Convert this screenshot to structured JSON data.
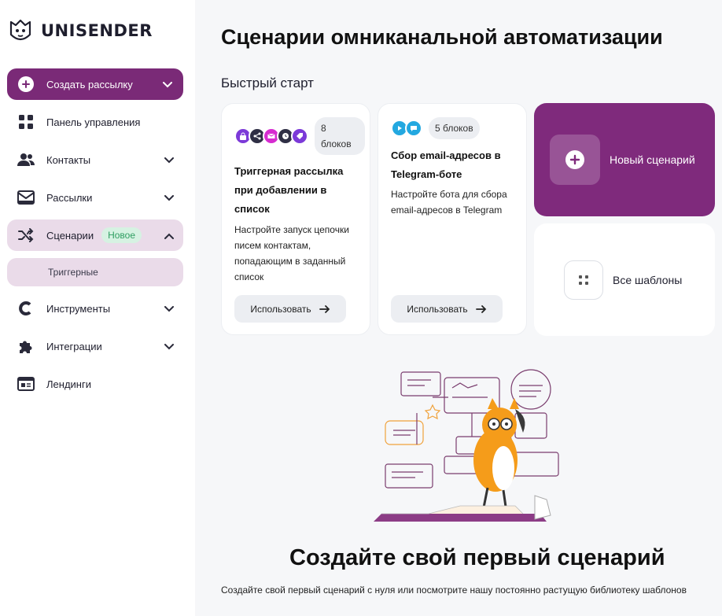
{
  "brand": {
    "name": "UNISENDER"
  },
  "sidebar": {
    "create_label": "Создать рассылку",
    "items": [
      {
        "label": "Панель управления",
        "icon": "grid-icon"
      },
      {
        "label": "Контакты",
        "icon": "users-icon"
      },
      {
        "label": "Рассылки",
        "icon": "envelope-icon"
      },
      {
        "label": "Сценарии",
        "icon": "shuffle-icon",
        "badge": "Новое"
      },
      {
        "label": "Инструменты",
        "icon": "tools-icon"
      },
      {
        "label": "Интеграции",
        "icon": "puzzle-icon"
      },
      {
        "label": "Лендинги",
        "icon": "landing-icon"
      }
    ],
    "sub_item": "Триггерные"
  },
  "main": {
    "title": "Сценарии омниканальной автоматизации",
    "quick_start": "Быстрый старт",
    "cards": [
      {
        "blocks": "8 блоков",
        "title": "Триггерная рассылка при добавлении в список",
        "description": "Настройте запуск цепочки писем контактам, попадающим в заданный список",
        "button": "Использовать"
      },
      {
        "blocks": "5 блоков",
        "title": "Сбор email-адресов в Telegram-боте",
        "description": "Настройте бота для сбора email-адресов в Telegram",
        "button": "Использовать"
      }
    ],
    "new_scenario": "Новый сценарий",
    "all_templates": "Все шаблоны",
    "empty_title": "Создайте свой первый сценарий",
    "empty_description": "Создайте свой первый сценарий с нуля или посмотрите нашу постоянно растущую библиотеку шаблонов"
  },
  "colors": {
    "accent": "#7a2a77",
    "active_bg": "#eadbe9",
    "badge_green": "#2e9e61"
  }
}
